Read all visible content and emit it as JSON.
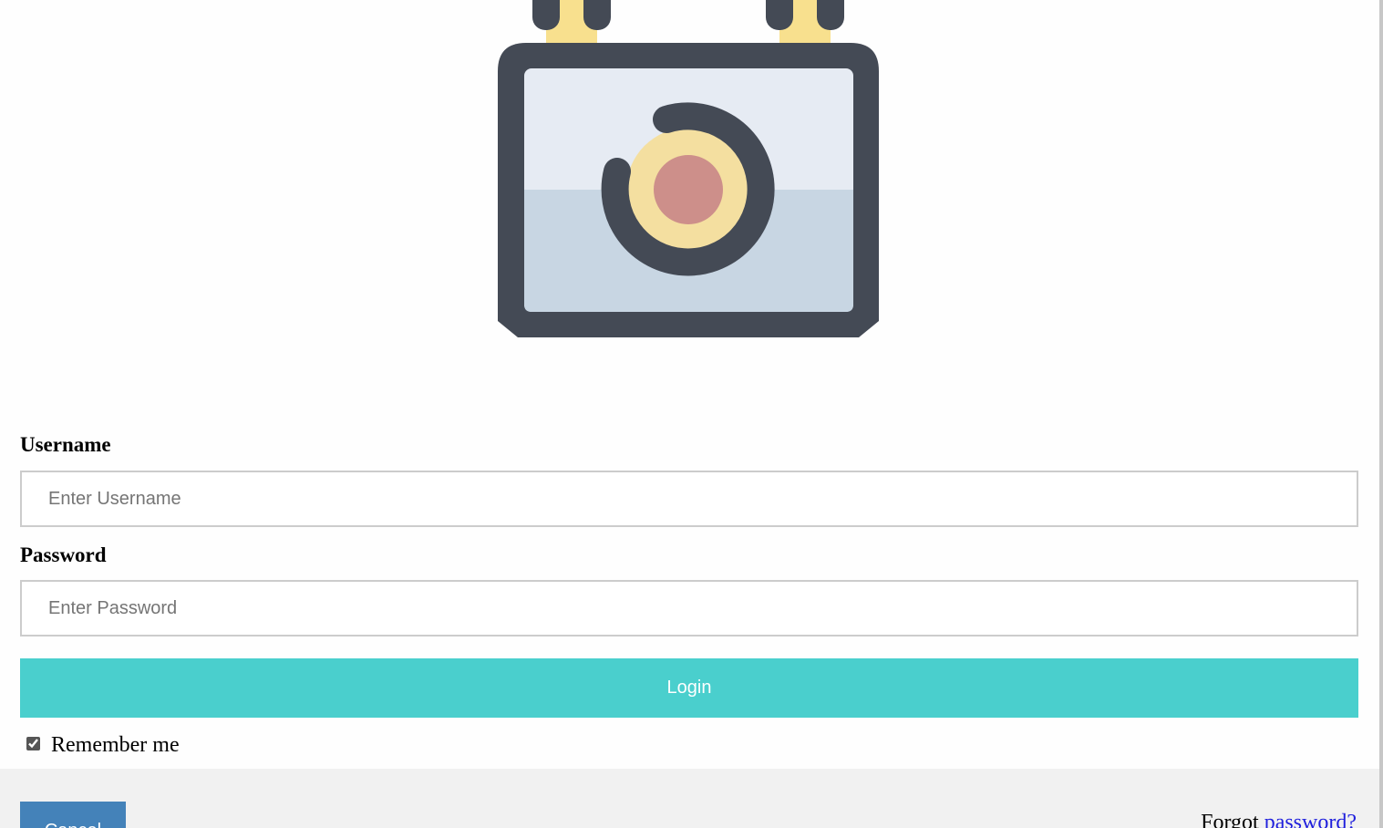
{
  "form": {
    "username_label": "Username",
    "username_placeholder": "Enter Username",
    "username_value": "",
    "password_label": "Password",
    "password_placeholder": "Enter Password",
    "password_value": "",
    "login_label": "Login",
    "remember_label": "Remember me",
    "remember_checked": true
  },
  "footer": {
    "cancel_label": "Cancel",
    "forgot_prefix": "Forgot ",
    "forgot_link": "password?"
  },
  "icons": {
    "hero": "padlock-icon"
  },
  "colors": {
    "login_button": "#4acfcd",
    "cancel_button": "#4482b9",
    "link": "#2020dd",
    "footer_background": "#f1f1f1",
    "lock_outline": "#444a55",
    "lock_shackle": "#f8e08e",
    "lock_body_top": "#e6ebf3",
    "lock_body_bottom": "#c8d6e3",
    "lock_ring": "#f4dfa0",
    "lock_center": "#cd8f8a"
  }
}
